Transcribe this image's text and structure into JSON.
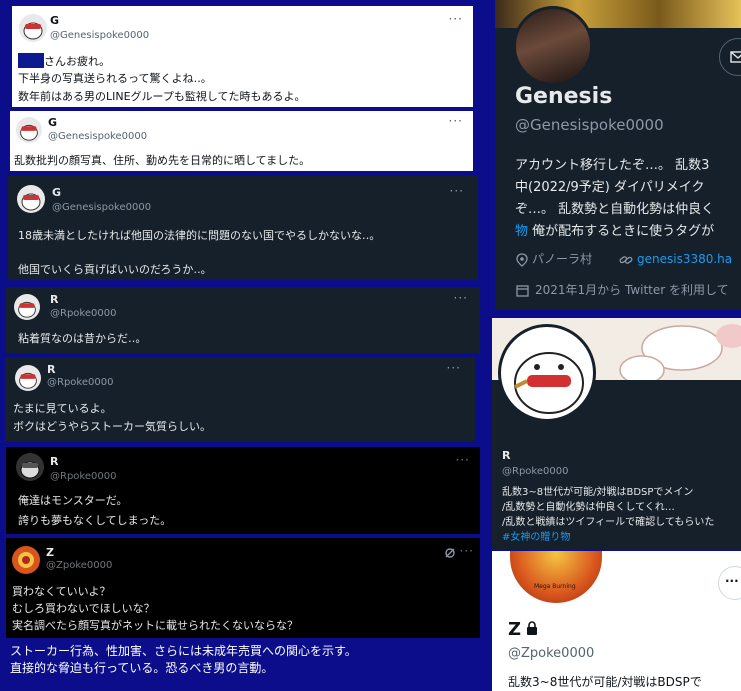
{
  "tweets": [
    {
      "name": "G",
      "handle": "@Genesispoke0000",
      "line1_suffix": "さんお疲れ。",
      "line2": "下半身の写真送られるって驚くよね‥。",
      "line3": "数年前はある男のLINEグループも監視してた時もあるよ。"
    },
    {
      "name": "G",
      "handle": "@Genesispoke0000",
      "line1": "乱数批判の顔写真、住所、勤め先を日常的に晒してました。"
    },
    {
      "name": "G",
      "handle": "@Genesispoke0000",
      "line1": "18歳未満としたければ他国の法律的に問題のない国でやるしかないな‥。",
      "line2": "他国でいくら貢げばいいのだろうか‥。"
    },
    {
      "name": "R",
      "handle": "@Rpoke0000",
      "line1": "粘着質なのは昔からだ‥。"
    },
    {
      "name": "R",
      "handle": "@Rpoke0000",
      "line1": "たまに見ているよ。",
      "line2": "ボクはどうやらストーカー気質らしい。"
    },
    {
      "name": "R",
      "handle": "@Rpoke0000",
      "line1": "俺達はモンスターだ。",
      "line2": "誇りも夢もなくしてしまった。"
    },
    {
      "name": "Z",
      "handle": "@Zpoke0000",
      "line1": "買わなくていいよ？",
      "line2": "むしろ買わないでほしいな？",
      "line3": "実名調べたら顔写真がネットに載せられたくないならな？"
    }
  ],
  "dots": "···",
  "caption": {
    "line1": "ストーカー行為、性加害、さらには未成年売買への関心を示す。",
    "line2": "直接的な脅迫も行っている。恐るべき男の言動。"
  },
  "profiles": {
    "genesis": {
      "name": "Genesis",
      "handle": "@Genesispoke0000",
      "bio1": "アカウント移行したぞ…。 乱数3",
      "bio2": "中(2022/9予定) ダイパリメイク",
      "bio3": "ぞ…。 乱数勢と自動化勢は仲良く",
      "bio4_link": "物",
      "bio4": " 俺が配布するときに使うタグが",
      "location": "パノーラ村",
      "website": "genesis3380.ha",
      "joined": "2021年1月から Twitter を利用して"
    },
    "r": {
      "name": "R",
      "handle": "@Rpoke0000",
      "bio1": "乱数3~8世代が可能/対戦はBDSPでメイン",
      "bio2": "/乱数勢と自動化勢は仲良くしてくれ…",
      "bio3": "/乱数と戦績はツイフィールで確認してもらいた",
      "tag": "#女神の贈り物"
    },
    "z": {
      "name": "Z",
      "handle": "@Zpoke0000",
      "bio": "乱数3~8世代が可能/対戦はBDSPで",
      "avatar_text": "Mega Burning"
    }
  },
  "colors": {
    "background": "#0b0d8a",
    "link": "#1d9bf0",
    "dim_card": "#15202b",
    "black_card": "#000000"
  }
}
